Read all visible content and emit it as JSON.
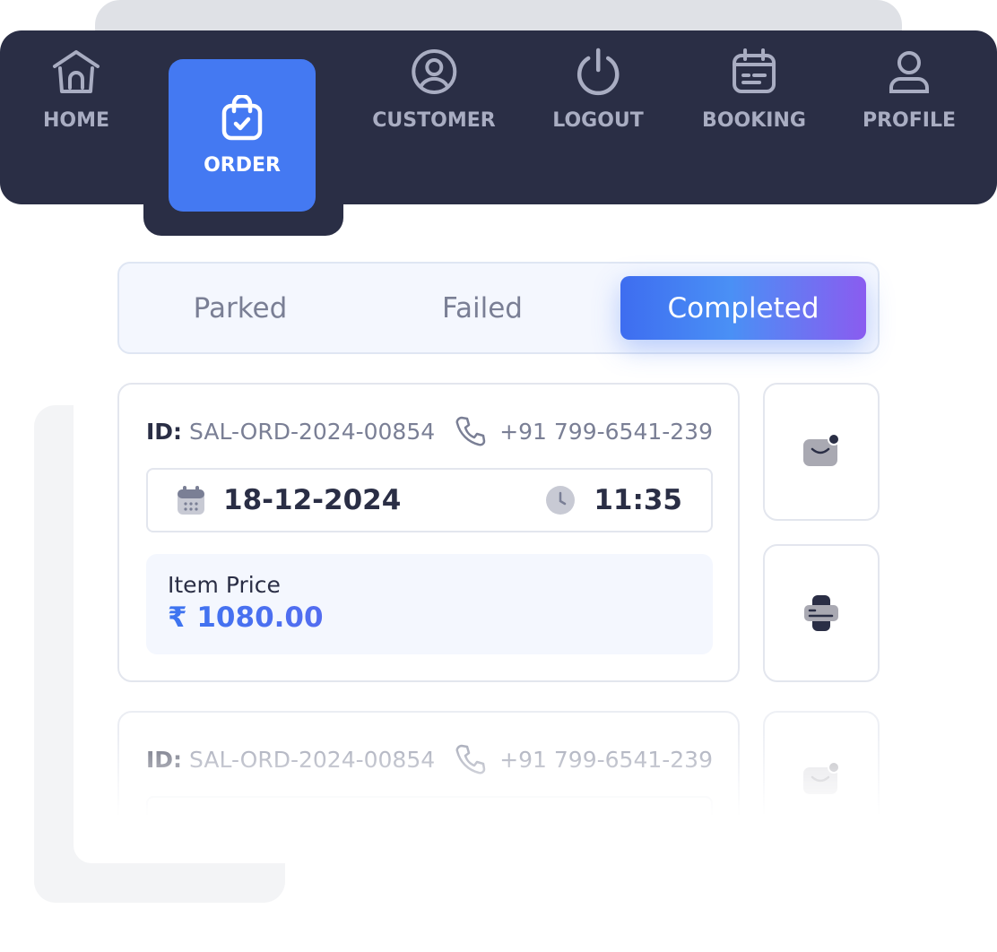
{
  "nav": {
    "items": [
      {
        "label": "HOME",
        "icon": "home-icon"
      },
      {
        "label": "ORDER",
        "icon": "shopping-bag-check-icon",
        "active": true
      },
      {
        "label": "CUSTOMER",
        "icon": "user-circle-icon"
      },
      {
        "label": "LOGOUT",
        "icon": "power-icon"
      },
      {
        "label": "BOOKING",
        "icon": "calendar-icon"
      },
      {
        "label": "PROFILE",
        "icon": "user-icon"
      }
    ],
    "accent": "#4479f2",
    "background": "#2a2e45"
  },
  "tabs": [
    {
      "label": "Parked"
    },
    {
      "label": "Failed"
    },
    {
      "label": "Completed",
      "active": true
    }
  ],
  "orders": [
    {
      "id_label": "ID:",
      "id": "SAL-ORD-2024-00854",
      "phone": "+91 799-6541-239",
      "date": "18-12-2024",
      "time": "11:35",
      "price_label": "Item Price",
      "price": "₹ 1080.00"
    },
    {
      "id_label": "ID:",
      "id": "SAL-ORD-2024-00854",
      "phone": "+91 799-6541-239"
    }
  ],
  "actions": [
    {
      "icon": "message-icon"
    },
    {
      "icon": "printer-icon"
    },
    {
      "icon": "message-icon"
    }
  ]
}
